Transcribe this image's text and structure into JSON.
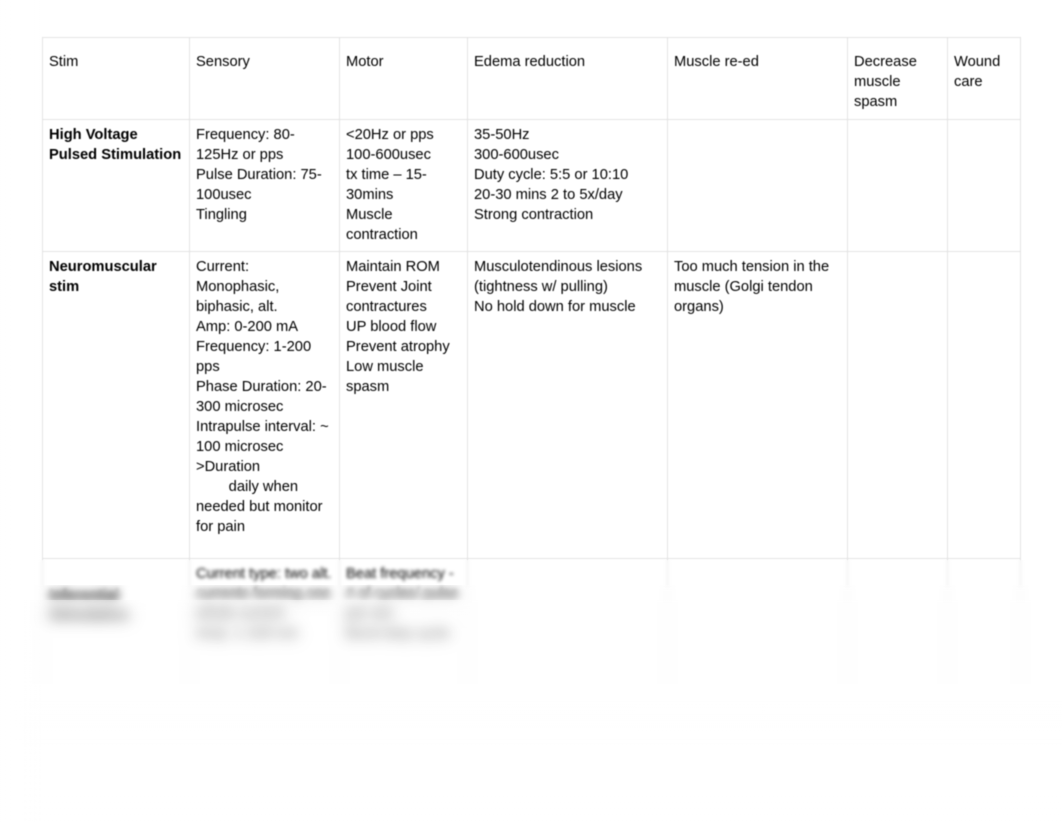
{
  "document": {
    "type": "table",
    "title": "Electrical Stimulation Parameters Chart"
  },
  "table": {
    "headers": [
      "Stim",
      "Sensory",
      "Motor",
      "Edema reduction",
      "Muscle re-ed",
      "Decrease muscle spasm",
      "Wound care"
    ],
    "rows": [
      {
        "stim": "High Voltage Pulsed Stimulation",
        "sensory": "Frequency: 80-125Hz or pps\nPulse Duration: 75-100usec\nTingling",
        "motor": "<20Hz or pps\n100-600usec\ntx time – 15-30mins\nMuscle contraction",
        "edema_reduction": "35-50Hz\n300-600usec\nDuty cycle: 5:5 or 10:10\n20-30 mins 2 to 5x/day\nStrong contraction",
        "muscle_re_ed": "",
        "decrease_muscle_spasm": "",
        "wound_care": ""
      },
      {
        "stim": "Neuromuscular stim",
        "sensory": "Current: Monophasic, biphasic, alt.\nAmp: 0-200 mA\nFrequency: 1-200 pps\nPhase Duration: 20-300 microsec\nIntrapulse interval: ~ 100 microsec\n>Duration\n        daily when needed but monitor for pain",
        "motor": "Maintain ROM\nPrevent Joint contractures\nUP blood flow\nPrevent atrophy\nLow muscle spasm",
        "edema_reduction": "Musculotendinous lesions (tightness w/ pulling)\nNo hold down for muscle",
        "muscle_re_ed": "Too much tension in the muscle (Golgi tendon organs)",
        "decrease_muscle_spasm": "",
        "wound_care": ""
      },
      {
        "stim": "Inferential Stimulation",
        "sensory": "Current type: two alt. currents forming one whole current\nAmp: 1-100 mA",
        "motor": "Beat frequency - # of cycles/ pulse per sec\nBurst duty cycle",
        "edema_reduction": "",
        "muscle_re_ed": "",
        "decrease_muscle_spasm": "",
        "wound_care": ""
      }
    ]
  },
  "colors": {
    "page_background": "#ffffff",
    "text": "#000000",
    "border": "#e3e3e3"
  }
}
